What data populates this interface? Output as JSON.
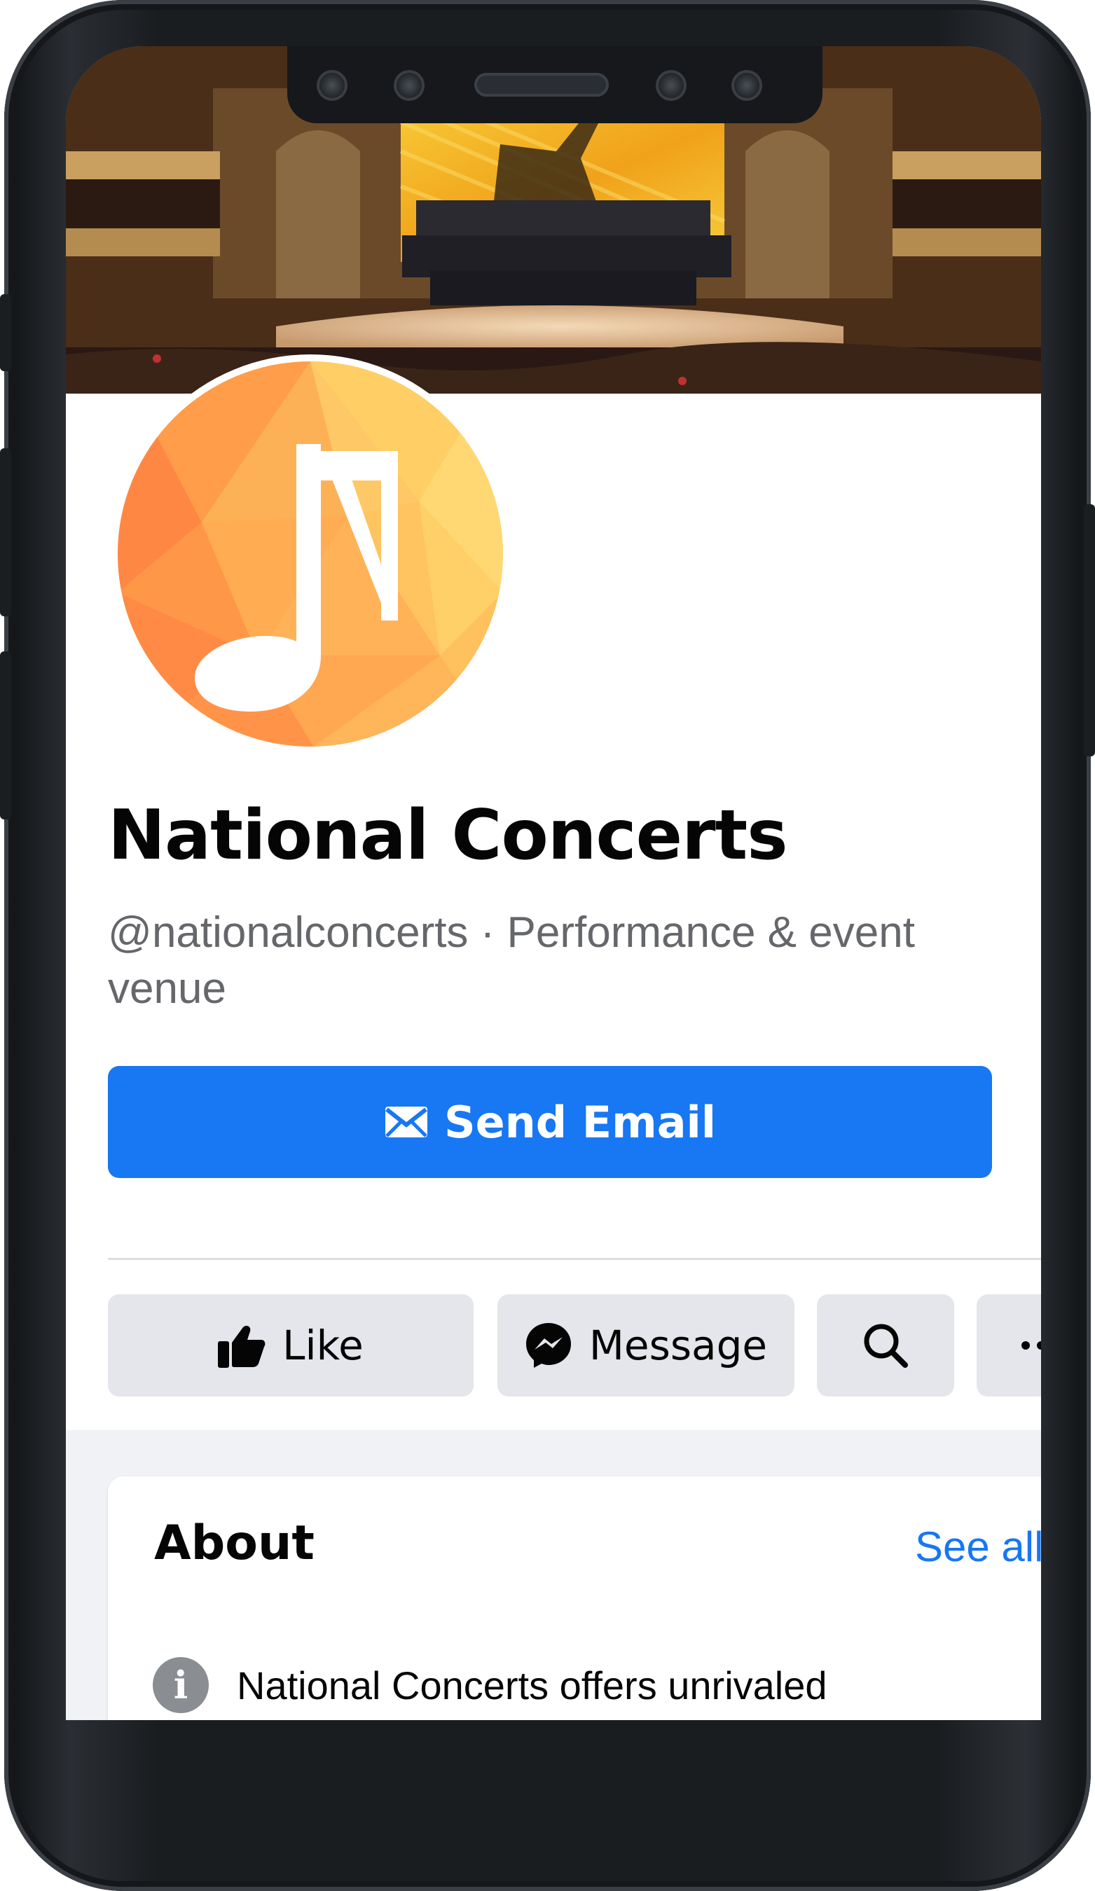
{
  "page": {
    "title": "National Concerts",
    "subtitle": "@nationalconcerts · Performance & event venue"
  },
  "primary_action": {
    "label": "Send Email",
    "icon": "envelope-icon"
  },
  "actions": [
    {
      "label": "Like",
      "icon": "thumbs-up-icon"
    },
    {
      "label": "Message",
      "icon": "messenger-icon"
    },
    {
      "label": "",
      "icon": "search-icon"
    },
    {
      "label": "",
      "icon": "more-icon"
    }
  ],
  "about": {
    "title": "About",
    "see_all": "See all",
    "description": "National Concerts offers unrivaled"
  },
  "colors": {
    "accent": "#1877f2",
    "secondary_text": "#65676b",
    "button_gray": "#e4e6eb",
    "feed_bg": "#f0f2f5"
  }
}
